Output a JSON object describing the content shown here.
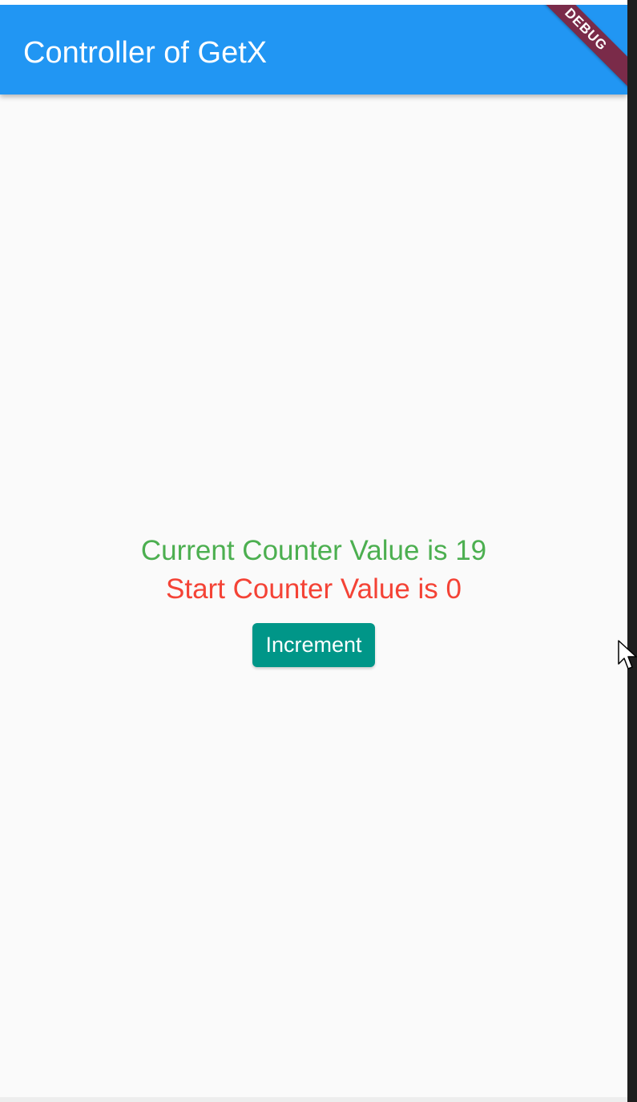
{
  "app_bar": {
    "title": "Controller of GetX",
    "color": "#2196f3"
  },
  "debug_banner": {
    "label": "DEBUG",
    "color": "#7a2b49"
  },
  "counter": {
    "current_text": "Current Counter Value is 19",
    "current_color": "#4caf50",
    "start_text": "Start Counter Value is 0",
    "start_color": "#f44336"
  },
  "increment_button": {
    "label": "Increment",
    "color": "#009688"
  },
  "icons": {
    "cursor": "mouse-pointer-icon"
  }
}
